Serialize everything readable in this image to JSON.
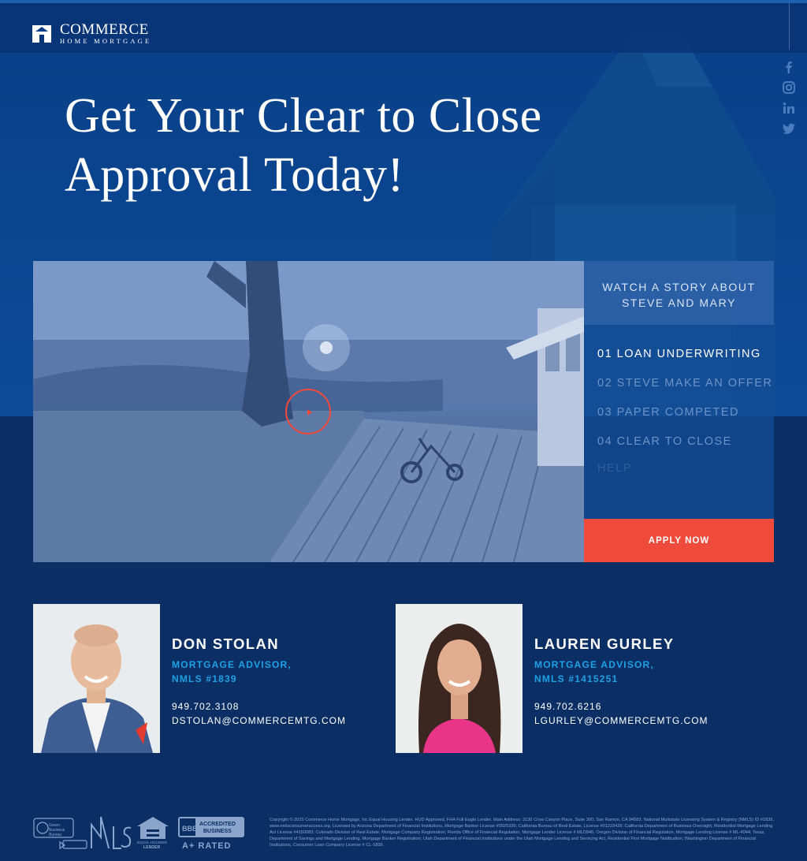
{
  "brand": {
    "name": "COMMERCE",
    "tagline": "HOME MORTGAGE"
  },
  "colors": {
    "background": "#0b2f65",
    "hero": "#0b4590",
    "accent_red": "#f04a3b",
    "advisor_title_blue": "#1da1e6"
  },
  "social": [
    "facebook-icon",
    "instagram-icon",
    "linkedin-icon",
    "twitter-icon"
  ],
  "hero": {
    "title_line1": "Get Your Clear to Close",
    "title_line2": "Approval Today!"
  },
  "video": {
    "play_icon": "play-icon",
    "panel_heading_line1": "WATCH A STORY ABOUT",
    "panel_heading_line2": "STEVE AND MARY",
    "chapters": [
      {
        "label": "01 LOAN UNDERWRITING"
      },
      {
        "label": "02 STEVE MAKE AN OFFER"
      },
      {
        "label": "03 PAPER COMPETED"
      },
      {
        "label": "04 CLEAR TO CLOSE"
      },
      {
        "label": "HELP"
      }
    ],
    "apply_label": "APPLY NOW"
  },
  "advisors": [
    {
      "name": "DON STOLAN",
      "title_line1": "MORTGAGE ADVISOR,",
      "title_line2": "NMLS #1839",
      "phone": "949.702.3108",
      "email": "DSTOLAN@COMMERCEMTG.COM"
    },
    {
      "name": "LAUREN GURLEY",
      "title_line1": "MORTGAGE ADVISOR,",
      "title_line2": "NMLS #1415251",
      "phone": "949.702.6216",
      "email": "LGURLEY@COMMERCEMTG.COM"
    }
  ],
  "footer": {
    "logos": {
      "bbb_green": "Green Business Bureau",
      "nmls": "NMLS",
      "equal_housing": "EQUAL HOUSING LENDER",
      "bbb_accredited_line1": "ACCREDITED",
      "bbb_accredited_line2": "BUSINESS",
      "bbb_rating": "A+ RATED"
    },
    "disclaimer": "Copyright © 2015 Commerce Home Mortgage, Inc Equal Housing Lender. HUD Approved, FHA Full Eagle Lender. Main Address: 3130 Crow Canyon Place, Suite 300, San Ramon, CA 94583. National Multistate Licensing System & Registry (NMLS) ID #1839, www.nmlsconsumeraccess.org. Licensed by Arizona Department of Financial Institutions, Mortgage Banker License #0925326; California Bureau of Real Estate, License #01218426; California Department of Business Oversight, Residential Mortgage Lending Act License #4150083; Colorado Division of Real Estate, Mortgage Company Registration; Florida Office of Financial Regulation, Mortgage Lender License # MLD946; Oregon Division of Financial Regulation, Mortgage Lending License # ML-4044; Texas Department of Savings and Mortgage Lending, Mortgage Banker Registration; Utah Department of Financial Institutions under the Utah Mortgage Lending and Servicing Act, Residential First Mortgage Notification; Washington Department of Financial Institutions, Consumer Loan Company License # CL-1839."
  }
}
